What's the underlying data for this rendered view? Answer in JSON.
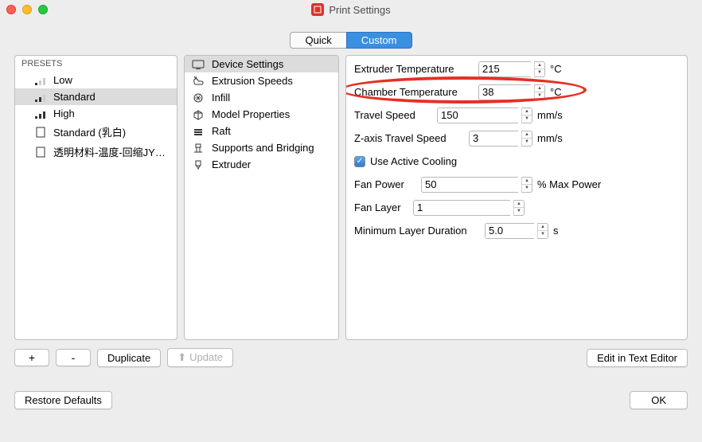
{
  "window": {
    "title": "Print Settings"
  },
  "tabs": {
    "quick": "Quick",
    "custom": "Custom"
  },
  "presets": {
    "header": "PRESETS",
    "items": [
      {
        "label": "Low",
        "icon": "bars-low"
      },
      {
        "label": "Standard",
        "icon": "bars-std"
      },
      {
        "label": "High",
        "icon": "bars-high"
      },
      {
        "label": "Standard (乳白)",
        "icon": "doc"
      },
      {
        "label": "透明材料-温度-回缩JY…",
        "icon": "doc"
      }
    ]
  },
  "categories": {
    "items": [
      {
        "label": "Device Settings",
        "icon": "device"
      },
      {
        "label": "Extrusion Speeds",
        "icon": "extrude"
      },
      {
        "label": "Infill",
        "icon": "infill"
      },
      {
        "label": "Model Properties",
        "icon": "model"
      },
      {
        "label": "Raft",
        "icon": "raft"
      },
      {
        "label": "Supports and Bridging",
        "icon": "supports"
      },
      {
        "label": "Extruder",
        "icon": "extruder"
      }
    ]
  },
  "settings": {
    "extruder_temp": {
      "label": "Extruder Temperature",
      "value": "215",
      "unit": "°C"
    },
    "chamber_temp": {
      "label": "Chamber Temperature",
      "value": "38",
      "unit": "°C"
    },
    "travel_speed": {
      "label": "Travel Speed",
      "value": "150",
      "unit": "mm/s"
    },
    "z_travel": {
      "label": "Z-axis Travel Speed",
      "value": "3",
      "unit": "mm/s"
    },
    "cooling": {
      "label": "Use Active Cooling"
    },
    "fan_power": {
      "label": "Fan Power",
      "value": "50",
      "unit": "% Max Power"
    },
    "fan_layer": {
      "label": "Fan Layer",
      "value": "1"
    },
    "min_layer": {
      "label": "Minimum Layer Duration",
      "value": "5.0",
      "unit": "s"
    }
  },
  "buttons": {
    "add": "+",
    "remove": "-",
    "duplicate": "Duplicate",
    "update": "Update",
    "edit_text": "Edit in Text Editor",
    "restore": "Restore Defaults",
    "ok": "OK"
  }
}
